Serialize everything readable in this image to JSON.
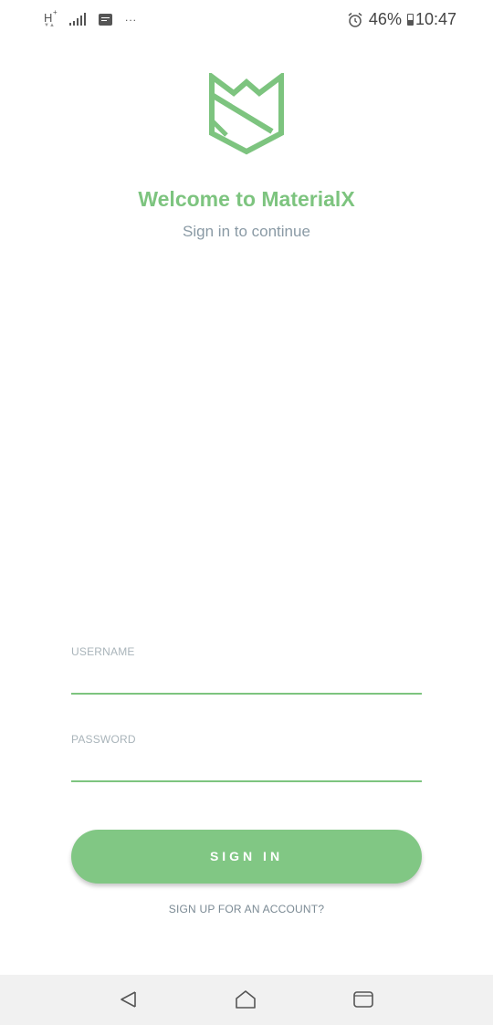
{
  "status_bar": {
    "network_type": "H",
    "network_plus": "+",
    "more_indicator": "...",
    "battery_percent": "46%",
    "time": "10:47",
    "icons": [
      "network-type-icon",
      "signal-icon",
      "message-notification-icon",
      "more-icon",
      "alarm-icon",
      "battery-icon"
    ]
  },
  "app": {
    "logo_icon": "materialx-logo-icon",
    "accent_color": "#7dc47f",
    "title": "Welcome to MaterialX",
    "subtitle": "Sign in to continue"
  },
  "form": {
    "username": {
      "label": "USERNAME",
      "value": ""
    },
    "password": {
      "label": "PASSWORD",
      "value": ""
    },
    "signin_label": "SIGN IN",
    "signup_label": "SIGN UP FOR AN ACCOUNT?"
  },
  "nav_bar": {
    "icons": [
      "back-icon",
      "home-icon",
      "recents-icon"
    ]
  }
}
